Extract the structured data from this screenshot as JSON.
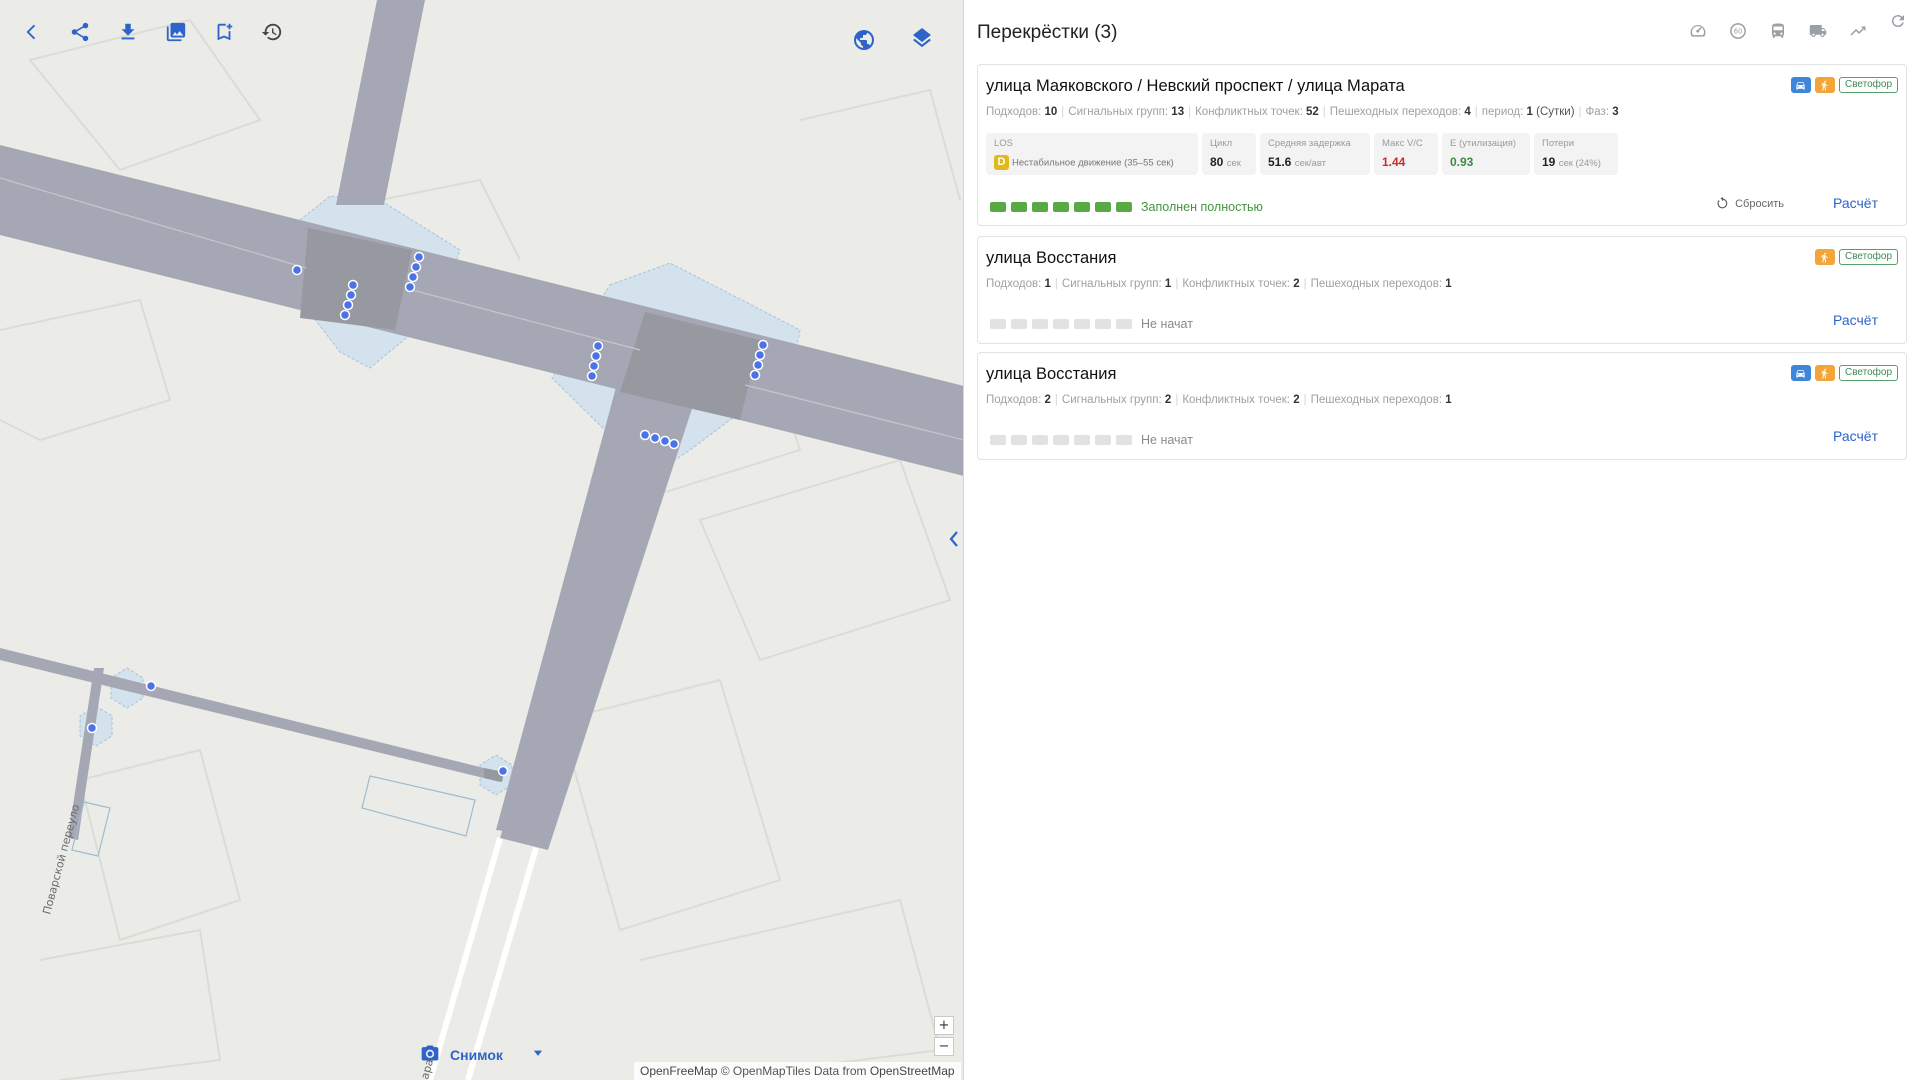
{
  "map": {
    "labels": {
      "street_a": "Поварской переуло",
      "street_b": "ара"
    },
    "snapshot": {
      "label": "Снимок"
    },
    "zoom": {
      "plus": "+",
      "minus": "−"
    },
    "attribution": {
      "part1": "OpenFreeMap",
      "part2": " © OpenMapTiles ",
      "part3": "Data from ",
      "part4": "OpenStreetMap"
    },
    "icons": [
      "back-icon",
      "share-icon",
      "download-icon",
      "image-icon",
      "bookmark-add-icon",
      "history-icon",
      "globe-icon",
      "layers-icon",
      "camera-icon",
      "chevron-down-icon"
    ]
  },
  "panel": {
    "title": "Перекрёстки (3)",
    "header_icons": [
      "speedometer-icon",
      "speed-limit-60-icon",
      "bus-icon",
      "truck-icon",
      "trending-up-icon",
      "refresh-icon"
    ],
    "speed_limit_text": "60"
  },
  "labels": {
    "approaches": "Подходов:",
    "signal_groups": "Сигнальных групп:",
    "conflict_points": "Конфликтных точек:",
    "crossings": "Пешеходных переходов:",
    "period": "период:",
    "phases": "Фаз:",
    "calc": "Расчёт",
    "reset": "Сбросить"
  },
  "cards": [
    {
      "title": "улица Маяковского / Невский проспект / улица Марата",
      "badge": "Светофор",
      "approaches": "10",
      "signal_groups": "13",
      "conflict_points": "52",
      "crossings": "4",
      "period_value": "1",
      "period_unit": "(Сутки)",
      "phases": "3",
      "metrics": {
        "los_label": "LOS",
        "los_value": "D",
        "los_desc": "Нестабильное движение (35–55 сек)",
        "cycle_label": "Цикл",
        "cycle_value": "80",
        "cycle_unit": "сек",
        "delay_label": "Средняя задержка",
        "delay_value": "51.6",
        "delay_unit": "сек/авт",
        "vc_label": "Макс V/C",
        "vc_value": "1.44",
        "util_label": "E (утилизация)",
        "util_value": "0.93",
        "loss_label": "Потери",
        "loss_value": "19",
        "loss_unit": "сек (24%)"
      },
      "progress_filled": 7,
      "progress_total": 7,
      "progress_label": "Заполнен полностью"
    },
    {
      "title": "улица Восстания",
      "badge": "Светофор",
      "approaches": "1",
      "signal_groups": "1",
      "conflict_points": "2",
      "crossings": "1",
      "progress_filled": 0,
      "progress_total": 7,
      "progress_label": "Не начат"
    },
    {
      "title": "улица Восстания",
      "badge": "Светофор",
      "approaches": "2",
      "signal_groups": "2",
      "conflict_points": "2",
      "crossings": "1",
      "progress_filled": 0,
      "progress_total": 7,
      "progress_label": "Не начат"
    }
  ],
  "colors": {
    "accent": "#2e63c9",
    "badge_blue": "#3f85d9",
    "badge_orange": "#f2a63a",
    "progress_done": "#5aa947",
    "los_d": "#e2b81a",
    "map_bg": "#ebece7",
    "road": "#a5a8b4",
    "intersection_zone": "#d4e3ee",
    "node": "#4c72e8"
  }
}
